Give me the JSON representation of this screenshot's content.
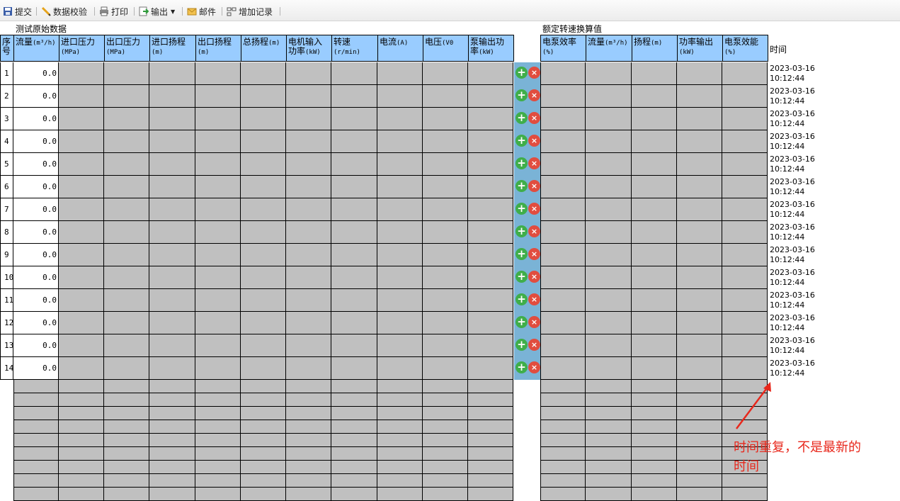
{
  "toolbar": {
    "submit": "提交",
    "validate": "数据校验",
    "print": "打印",
    "export": "输出",
    "mail": "邮件",
    "add_record": "增加记录"
  },
  "sections": {
    "raw": "测试原始数据",
    "rated": "额定转速换算值"
  },
  "raw_headers": [
    {
      "label": "序号",
      "unit": ""
    },
    {
      "label": "流量",
      "unit": "(m³/h)"
    },
    {
      "label": "进口压力",
      "unit": "(MPa)"
    },
    {
      "label": "出口压力",
      "unit": "(MPa)"
    },
    {
      "label": "进口扬程",
      "unit": "(m)"
    },
    {
      "label": "出口扬程",
      "unit": "(m)"
    },
    {
      "label": "总扬程",
      "unit": "(m)"
    },
    {
      "label": "电机输入功率",
      "unit": "(kW)"
    },
    {
      "label": "转速",
      "unit": "(r/min)"
    },
    {
      "label": "电流",
      "unit": "(A)"
    },
    {
      "label": "电压",
      "unit": "(V0"
    },
    {
      "label": "泵输出功率",
      "unit": "(kW)"
    }
  ],
  "rated_headers": [
    {
      "label": "电泵效率",
      "unit": "(%)"
    },
    {
      "label": "流量",
      "unit": "(m³/h)"
    },
    {
      "label": "扬程",
      "unit": "(m)"
    },
    {
      "label": "功率输出",
      "unit": "(kW)"
    },
    {
      "label": "电泵效能",
      "unit": "(%)"
    }
  ],
  "time_header": "时间",
  "rows": [
    {
      "idx": "1",
      "flow": "0.0",
      "date": "2023-03-16",
      "time": "10:12:44"
    },
    {
      "idx": "2",
      "flow": "0.0",
      "date": "2023-03-16",
      "time": "10:12:44"
    },
    {
      "idx": "3",
      "flow": "0.0",
      "date": "2023-03-16",
      "time": "10:12:44"
    },
    {
      "idx": "4",
      "flow": "0.0",
      "date": "2023-03-16",
      "time": "10:12:44"
    },
    {
      "idx": "5",
      "flow": "0.0",
      "date": "2023-03-16",
      "time": "10:12:44"
    },
    {
      "idx": "6",
      "flow": "0.0",
      "date": "2023-03-16",
      "time": "10:12:44"
    },
    {
      "idx": "7",
      "flow": "0.0",
      "date": "2023-03-16",
      "time": "10:12:44"
    },
    {
      "idx": "8",
      "flow": "0.0",
      "date": "2023-03-16",
      "time": "10:12:44"
    },
    {
      "idx": "9",
      "flow": "0.0",
      "date": "2023-03-16",
      "time": "10:12:44"
    },
    {
      "idx": "10",
      "flow": "0.0",
      "date": "2023-03-16",
      "time": "10:12:44"
    },
    {
      "idx": "11",
      "flow": "0.0",
      "date": "2023-03-16",
      "time": "10:12:44"
    },
    {
      "idx": "12",
      "flow": "0.0",
      "date": "2023-03-16",
      "time": "10:12:44"
    },
    {
      "idx": "13",
      "flow": "0.0",
      "date": "2023-03-16",
      "time": "10:12:44"
    },
    {
      "idx": "14",
      "flow": "0.0",
      "date": "2023-03-16",
      "time": "10:12:44"
    }
  ],
  "row_actions": {
    "add": "+",
    "delete": "×"
  },
  "annotation": {
    "line1": "时间重复，不是最新的",
    "line2": "时间",
    "color": "#e8281c"
  },
  "colors": {
    "header_bg": "#99ccff",
    "cell_gray": "#c0c0c0",
    "action_bg": "#7ab3d6",
    "add_green": "#3fae4a",
    "delete_red": "#e14d3f"
  }
}
